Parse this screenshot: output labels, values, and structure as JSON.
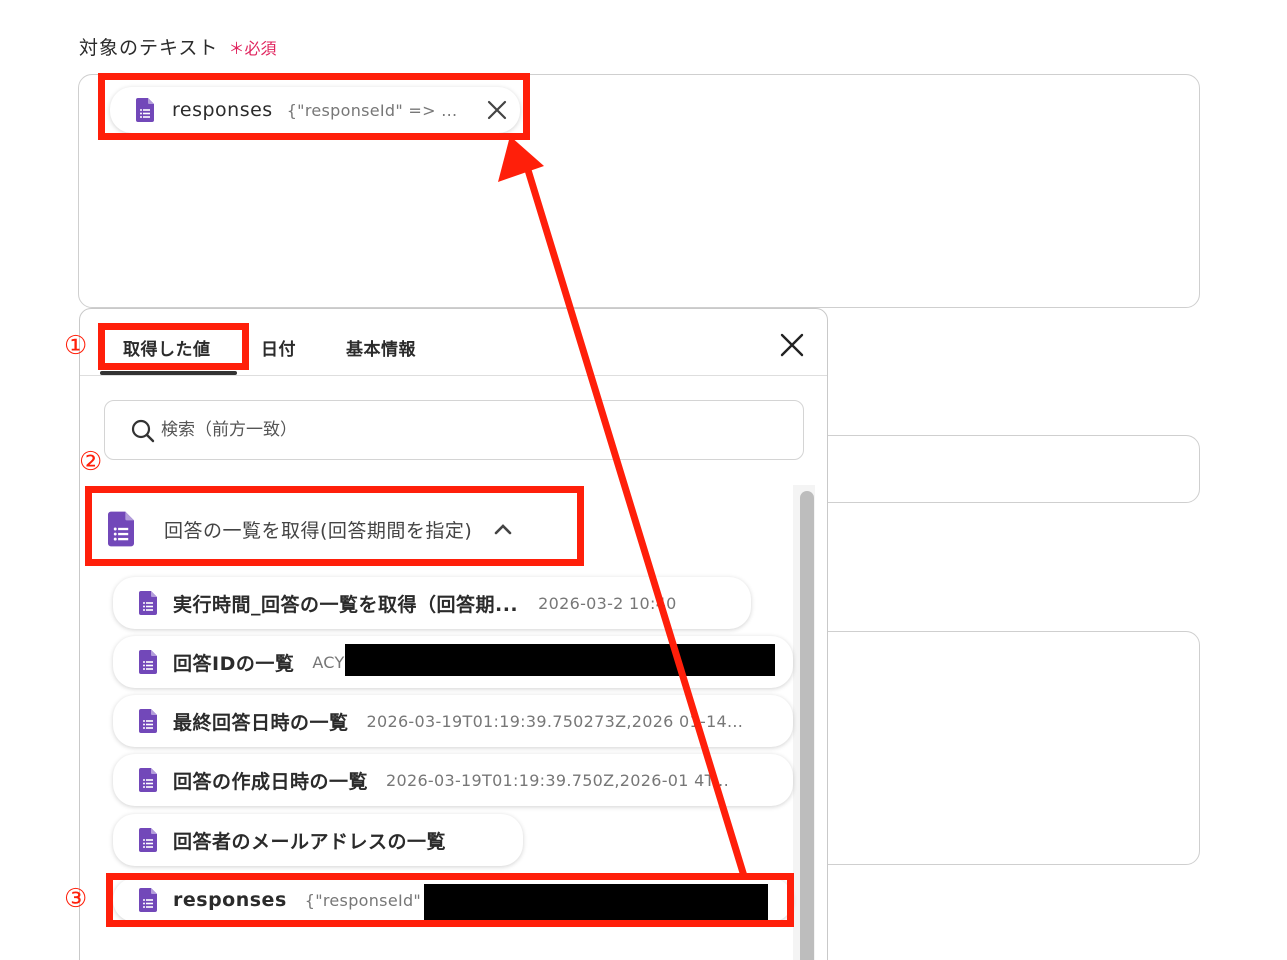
{
  "field": {
    "label": "対象のテキスト",
    "required": "＊必須",
    "selected_chip": {
      "name": "responses",
      "value": "{\"responseId\" => ..."
    }
  },
  "panel": {
    "tabs": [
      {
        "label": "取得した値",
        "active": true
      },
      {
        "label": "日付",
        "active": false
      },
      {
        "label": "基本情報",
        "active": false
      }
    ],
    "search_placeholder": "検索（前方一致）",
    "group": {
      "title": "回答の一覧を取得(回答期間を指定)",
      "expanded": true,
      "items": [
        {
          "name": "実行時間_回答の一覧を取得（回答期...",
          "value": "2026-03-2 10:40"
        },
        {
          "name": "回答IDの一覧",
          "value": "ACY"
        },
        {
          "name": "最終回答日時の一覧",
          "value": "2026-03-19T01:19:39.750273Z,2026 01-14..."
        },
        {
          "name": "回答の作成日時の一覧",
          "value": "2026-03-19T01:19:39.750Z,2026-01 4T..."
        },
        {
          "name": "回答者のメールアドレスの一覧",
          "value": ""
        },
        {
          "name": "responses",
          "value": "{\"responseId\" "
        }
      ]
    }
  },
  "annotations": {
    "step1": "①",
    "step2": "②",
    "step3": "③",
    "color": "#ff1f0a"
  },
  "icons": {
    "form": "google-forms-icon",
    "close": "close-icon",
    "search": "search-icon",
    "chevron": "chevron-up-icon"
  },
  "colors": {
    "form_icon": "#7248b9",
    "required": "#e0245e",
    "annotation": "#ff1f0a"
  }
}
